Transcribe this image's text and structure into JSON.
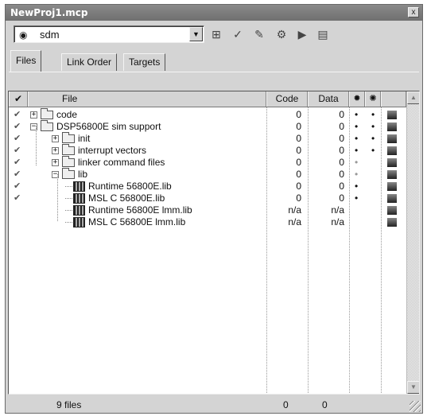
{
  "window": {
    "title": "NewProj1.mcp",
    "close_glyph": "x"
  },
  "toolbar": {
    "target_value": "sdm",
    "target_icon": "target-bullseye-icon",
    "buttons": [
      {
        "name": "target-settings-button",
        "icon": "settings-panel-icon",
        "glyph": "⊞"
      },
      {
        "name": "synchronize-button",
        "icon": "check-sync-icon",
        "glyph": "✓"
      },
      {
        "name": "make-button",
        "icon": "make-icon",
        "glyph": "✎"
      },
      {
        "name": "debug-button",
        "icon": "debug-icon",
        "glyph": "⚙"
      },
      {
        "name": "run-button",
        "icon": "run-icon",
        "glyph": "▶"
      },
      {
        "name": "project-inspector-button",
        "icon": "inspector-icon",
        "glyph": "▤"
      }
    ]
  },
  "tabs": [
    {
      "label": "Files",
      "active": true
    },
    {
      "label": "Link Order",
      "active": false
    },
    {
      "label": "Targets",
      "active": false
    }
  ],
  "columns": {
    "check_glyph": "✔",
    "file": "File",
    "code": "Code",
    "data": "Data",
    "debug_icon": "debug-column-icon",
    "touch_icon": "touch-column-icon"
  },
  "rows": [
    {
      "name": "code",
      "type": "folder",
      "depth": 0,
      "expander": "+",
      "checked": true,
      "code": "0",
      "data": "0",
      "debug": "•",
      "debug_grey": false,
      "target": "•"
    },
    {
      "name": "DSP56800E sim support",
      "type": "folder-open",
      "depth": 0,
      "expander": "−",
      "checked": true,
      "code": "0",
      "data": "0",
      "debug": "•",
      "debug_grey": false,
      "target": "•"
    },
    {
      "name": "init",
      "type": "folder",
      "depth": 1,
      "expander": "+",
      "checked": true,
      "code": "0",
      "data": "0",
      "debug": "•",
      "debug_grey": false,
      "target": "•"
    },
    {
      "name": "interrupt vectors",
      "type": "folder",
      "depth": 1,
      "expander": "+",
      "checked": true,
      "code": "0",
      "data": "0",
      "debug": "•",
      "debug_grey": false,
      "target": "•"
    },
    {
      "name": "linker command files",
      "type": "folder",
      "depth": 1,
      "expander": "+",
      "checked": true,
      "code": "0",
      "data": "0",
      "debug": "•",
      "debug_grey": true,
      "target": ""
    },
    {
      "name": "lib",
      "type": "folder-open",
      "depth": 1,
      "expander": "−",
      "checked": true,
      "code": "0",
      "data": "0",
      "debug": "•",
      "debug_grey": true,
      "target": ""
    },
    {
      "name": "Runtime 56800E.lib",
      "type": "lib",
      "depth": 2,
      "expander": "",
      "checked": true,
      "code": "0",
      "data": "0",
      "debug": "•",
      "debug_grey": false,
      "target": ""
    },
    {
      "name": "MSL C 56800E.lib",
      "type": "lib",
      "depth": 2,
      "expander": "",
      "checked": true,
      "code": "0",
      "data": "0",
      "debug": "•",
      "debug_grey": false,
      "target": ""
    },
    {
      "name": "Runtime 56800E lmm.lib",
      "type": "lib",
      "depth": 2,
      "expander": "",
      "checked": false,
      "code": "n/a",
      "data": "n/a",
      "debug": "",
      "debug_grey": false,
      "target": ""
    },
    {
      "name": "MSL C 56800E lmm.lib",
      "type": "lib",
      "depth": 2,
      "expander": "",
      "checked": false,
      "code": "n/a",
      "data": "n/a",
      "debug": "",
      "debug_grey": false,
      "target": ""
    }
  ],
  "status": {
    "files": "9 files",
    "code_total": "0",
    "data_total": "0"
  }
}
